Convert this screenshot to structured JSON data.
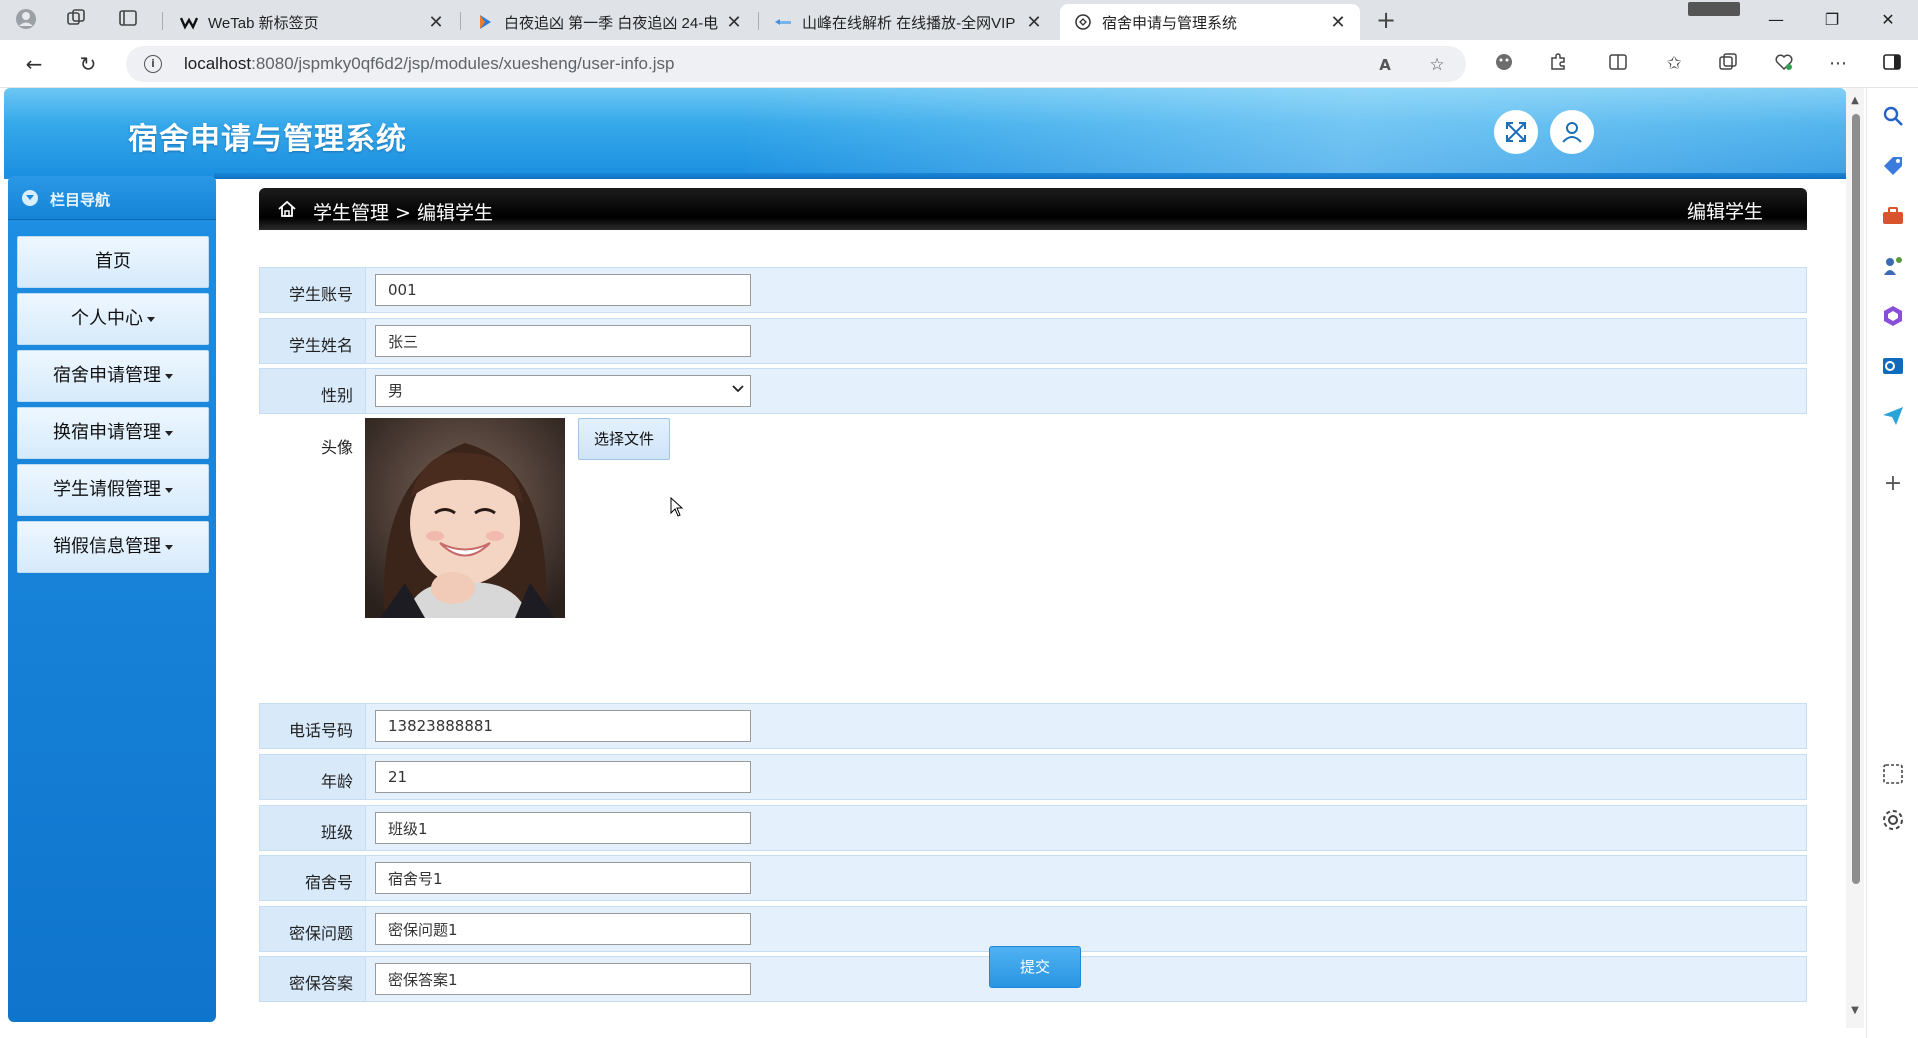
{
  "browser": {
    "tabs": [
      {
        "title": "WeTab 新标签页",
        "active": false
      },
      {
        "title": "白夜追凶 第一季 白夜追凶 24-电",
        "active": false
      },
      {
        "title": "山峰在线解析 在线播放-全网VIP",
        "active": false
      },
      {
        "title": "宿舍申请与管理系统",
        "active": true
      }
    ],
    "url_host": "localhost",
    "url_rest": ":8080/jspmky0qf6d2/jsp/modules/xuesheng/user-info.jsp"
  },
  "app": {
    "title": "宿舍申请与管理系统"
  },
  "sidebar": {
    "title": "栏目导航",
    "items": [
      {
        "label": "首页",
        "dropdown": false
      },
      {
        "label": "个人中心",
        "dropdown": true
      },
      {
        "label": "宿舍申请管理",
        "dropdown": true
      },
      {
        "label": "换宿申请管理",
        "dropdown": true
      },
      {
        "label": "学生请假管理",
        "dropdown": true
      },
      {
        "label": "销假信息管理",
        "dropdown": true
      }
    ]
  },
  "breadcrumb": {
    "path": "学生管理 > 编辑学生",
    "right_title": "编辑学生"
  },
  "form": {
    "account": {
      "label": "学生账号",
      "value": "001"
    },
    "name": {
      "label": "学生姓名",
      "value": "张三"
    },
    "gender": {
      "label": "性别",
      "value": "男"
    },
    "avatar": {
      "label": "头像",
      "button": "选择文件"
    },
    "phone": {
      "label": "电话号码",
      "value": "13823888881"
    },
    "age": {
      "label": "年龄",
      "value": "21"
    },
    "class": {
      "label": "班级",
      "value": "班级1"
    },
    "dorm": {
      "label": "宿舍号",
      "value": "宿舍号1"
    },
    "question": {
      "label": "密保问题",
      "value": "密保问题1"
    },
    "answer": {
      "label": "密保答案",
      "value": "密保答案1"
    },
    "submit": "提交"
  },
  "colors": {
    "header": "#1a8ee0",
    "sidebar": "#0f74cc",
    "row_bg": "#e4f0fc",
    "submit": "#2a95e2"
  }
}
